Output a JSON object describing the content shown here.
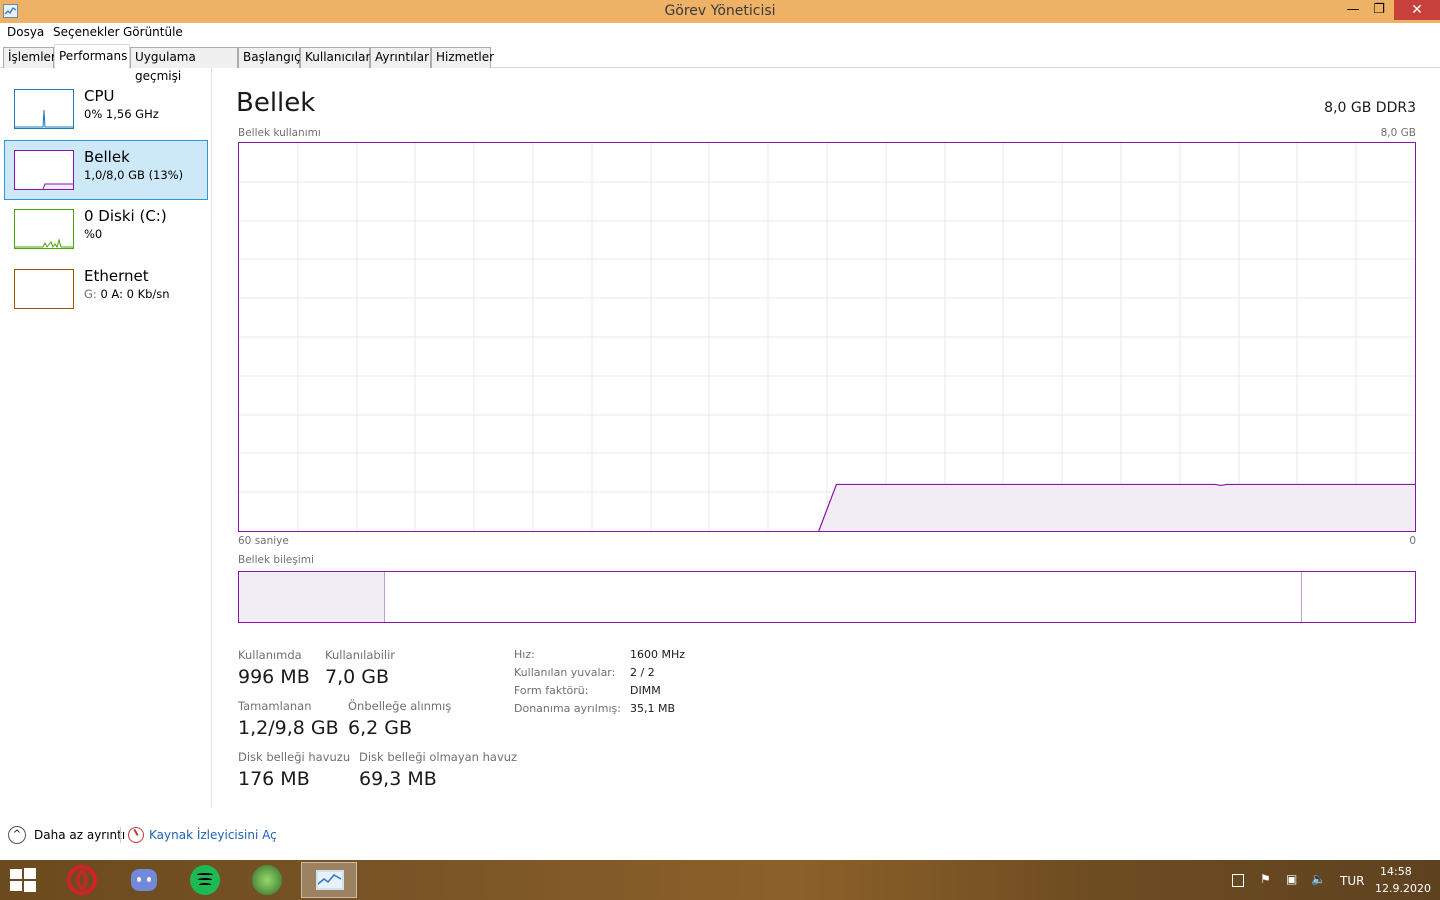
{
  "window": {
    "title": "Görev Yöneticisi",
    "minimize_glyph": "—",
    "restore_glyph": "❐",
    "close_glyph": "✕"
  },
  "menu": [
    "Dosya",
    "Seçenekler",
    "Görüntüle"
  ],
  "tabs": [
    "İşlemler",
    "Performans",
    "Uygulama geçmişi",
    "Başlangıç",
    "Kullanıcılar",
    "Ayrıntılar",
    "Hizmetler"
  ],
  "active_tab": "Performans",
  "sidebar": {
    "items": [
      {
        "name": "CPU",
        "sub": "0%  1,56 GHz",
        "color": "#1c7ab8"
      },
      {
        "name": "Bellek",
        "sub": "1,0/8,0 GB (13%)",
        "color": "#8b12ae"
      },
      {
        "name": "0 Diski (C:)",
        "sub": "%0",
        "color": "#4da60c"
      },
      {
        "name": "Ethernet",
        "sub_prefix": "G:",
        "sub": "0 A:  0 Kb/sn",
        "color": "#a74f01"
      }
    ]
  },
  "main": {
    "title": "Bellek",
    "spec": "8,0 GB DDR3",
    "usage_label": "Bellek kullanımı",
    "usage_max": "8,0 GB",
    "time_label": "60 saniye",
    "time_end": "0",
    "composition_label": "Bellek bileşimi",
    "accent": "#8b12ae",
    "usage_level": 0.12,
    "composition": {
      "in_use_fraction": 0.124,
      "available_boundary_fraction": 0.903
    }
  },
  "stats": {
    "in_use_label": "Kullanımda",
    "in_use": "996 MB",
    "available_label": "Kullanılabilir",
    "available": "7,0 GB",
    "committed_label": "Tamamlanan",
    "committed": "1,2/9,8 GB",
    "cached_label": "Önbelleğe alınmış",
    "cached": "6,2 GB",
    "paged_label": "Disk belleği havuzu",
    "paged": "176 MB",
    "nonpaged_label": "Disk belleği olmayan havuz",
    "nonpaged": "69,3 MB"
  },
  "specs": {
    "speed_label": "Hız:",
    "speed": "1600 MHz",
    "slots_label": "Kullanılan yuvalar:",
    "slots": "2 / 2",
    "form_label": "Form faktörü:",
    "form": "DIMM",
    "reserved_label": "Donanıma ayrılmış:",
    "reserved": "35,1 MB"
  },
  "footer": {
    "fewer_details": "Daha az ayrıntı",
    "open_resmon": "Kaynak İzleyicisini Aç"
  },
  "taskbar": {
    "apps": [
      "windows-start",
      "opera",
      "discord",
      "spotify",
      "game-app",
      "task-manager"
    ],
    "lang": "TUR",
    "time": "14:58",
    "date": "12.9.2020"
  }
}
